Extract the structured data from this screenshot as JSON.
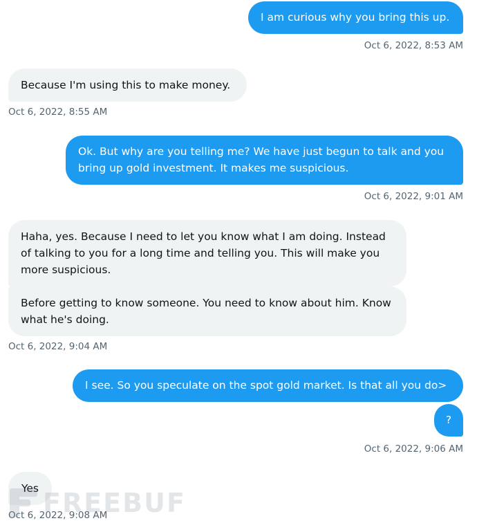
{
  "messages": [
    {
      "side": "out",
      "text": "I am curious why you bring this up."
    },
    {
      "side": "out",
      "time": "Oct 6, 2022, 8:53 AM"
    },
    {
      "side": "in",
      "text": "Because I'm using this to make money."
    },
    {
      "side": "in",
      "time": "Oct 6, 2022, 8:55 AM"
    },
    {
      "side": "out",
      "text": "Ok. But why are you telling me? We have just begun to talk and you bring up gold investment. It makes me suspicious."
    },
    {
      "side": "out",
      "time": "Oct 6, 2022, 9:01 AM"
    },
    {
      "side": "in",
      "text": "Haha, yes. Because I need to let you know what I am doing. Instead of talking to you for a long time and telling you. This will make you more suspicious."
    },
    {
      "side": "in",
      "text": "Before getting to know someone. You need to know about him. Know what he's doing."
    },
    {
      "side": "in",
      "time": "Oct 6, 2022, 9:04 AM"
    },
    {
      "side": "out",
      "text": "I see. So you speculate on the spot gold market. Is that all you do>"
    },
    {
      "side": "out",
      "text": "?"
    },
    {
      "side": "out",
      "time": "Oct 6, 2022, 9:06 AM"
    },
    {
      "side": "in",
      "text": "Yes"
    },
    {
      "side": "in",
      "time": "Oct 6, 2022, 9:08 AM"
    }
  ],
  "watermark": {
    "text": "FREEBUF",
    "color": "#6a7a86"
  },
  "colors": {
    "outgoing_bubble": "#1d9bf0",
    "incoming_bubble": "#eff3f4",
    "timestamp": "#536471"
  }
}
